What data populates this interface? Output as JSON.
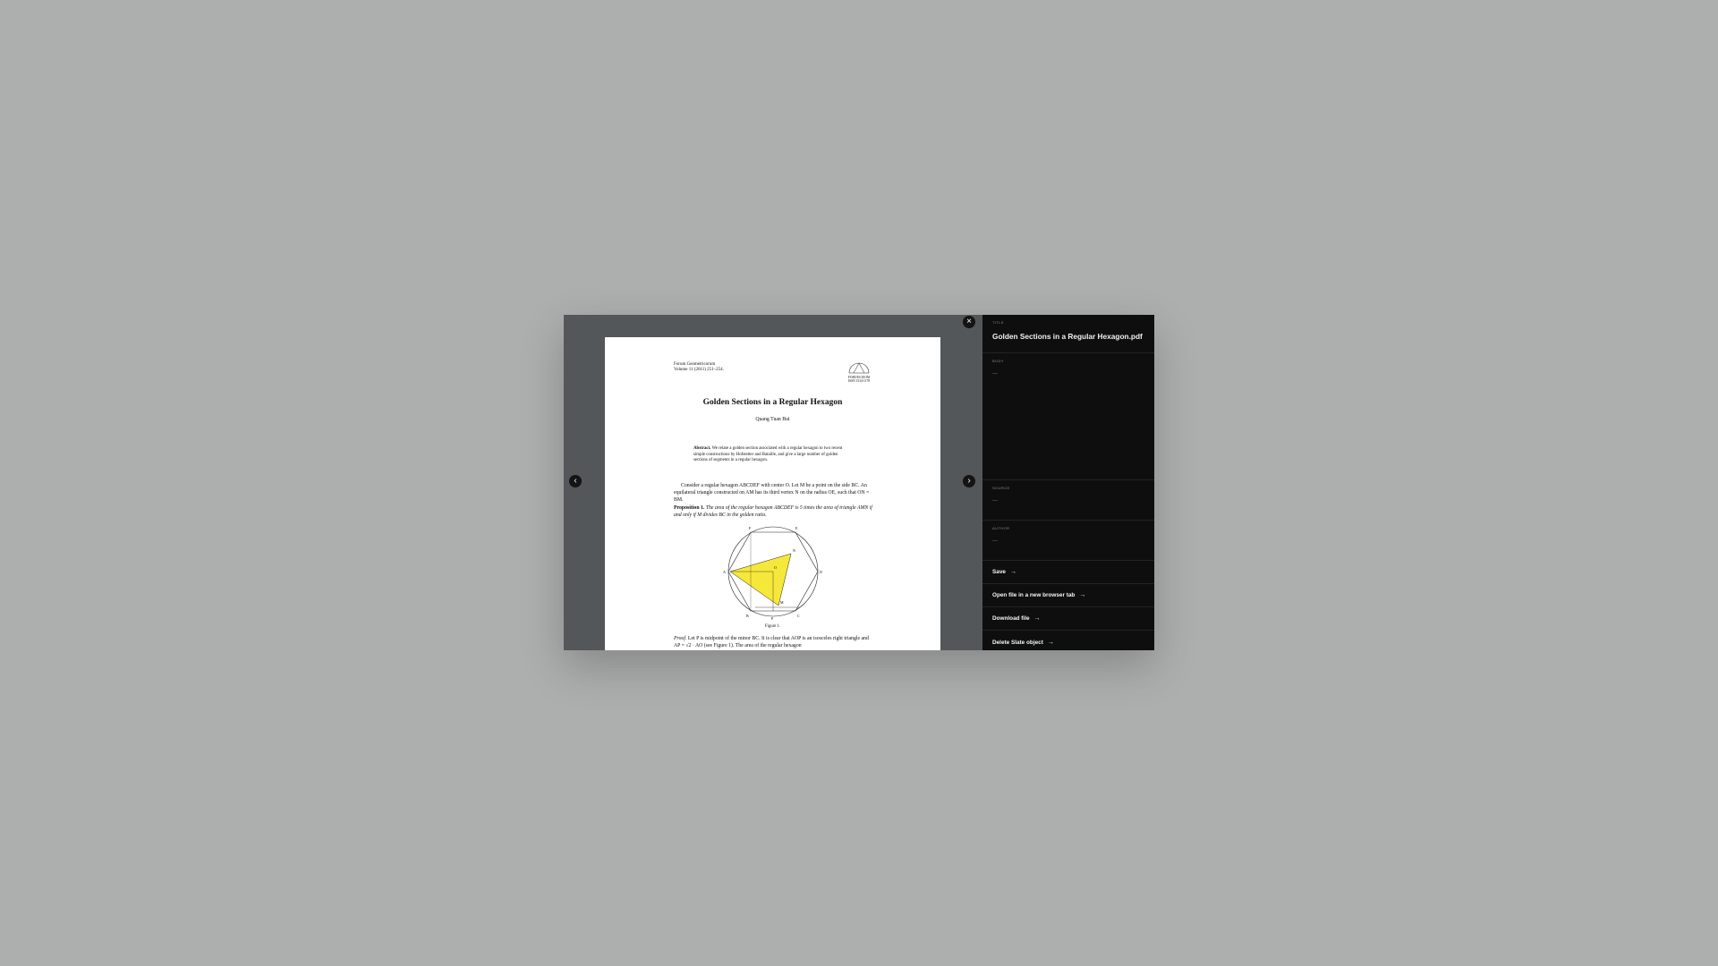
{
  "viewer": {
    "close_icon": "×",
    "prev_icon": "‹",
    "next_icon": "›",
    "page": {
      "journal_line1": "Forum Geometricorum",
      "journal_line2": "Volume 11 (2011) 251–254.",
      "logo_name": "FORUM GEOM",
      "issn": "ISSN 1534-1178",
      "title": "Golden Sections in a Regular Hexagon",
      "author": "Quang Tuan Bui",
      "abstract_label": "Abstract.",
      "abstract_text": "We relate a golden section associated with a regular hexagon to two recent simple constructions by Hofstetter and Bataille, and give a large number of golden sections of segments in a regular hexagon.",
      "para1": "Consider a regular hexagon ABCDEF with center O. Let M be a point on the side BC. An equilateral triangle constructed on AM has its third vertex N on the radius OE, such that ON = BM.",
      "prop_label": "Proposition 1.",
      "prop_text": "The area of the regular hexagon ABCDEF is 5 times the area of triangle AMN if and only if M divides BC in the golden ratio.",
      "figure_caption": "Figure 1.",
      "proof_label": "Proof.",
      "proof_text": "Let P is midpoint of the minor BC. It is clear that AOP is an isosceles right triangle and AP = √2 · AO (see Figure 1). The area of the regular hexagon",
      "fig_labels": {
        "F": "F",
        "E": "E",
        "A": "A",
        "D": "D",
        "B": "B",
        "C": "C",
        "O": "O",
        "N": "N",
        "M": "M",
        "P": "P"
      }
    }
  },
  "sidebar": {
    "title_label": "Title",
    "title_value": "Golden Sections in a Regular Hexagon.pdf",
    "body_label": "Body",
    "body_value": "—",
    "source_label": "Source",
    "source_value": "—",
    "author_label": "Author",
    "author_value": "—",
    "actions": [
      {
        "label": "Save",
        "arrow": "→"
      },
      {
        "label": "Open file in a new browser tab",
        "arrow": "→"
      },
      {
        "label": "Download file",
        "arrow": "→"
      },
      {
        "label": "Delete Slate object",
        "arrow": "→"
      }
    ]
  },
  "colors": {
    "backdrop": "#adafae",
    "viewer_bg": "#535759",
    "sidebar_bg": "#0e0e0e",
    "figure_highlight": "#f6e83a"
  }
}
